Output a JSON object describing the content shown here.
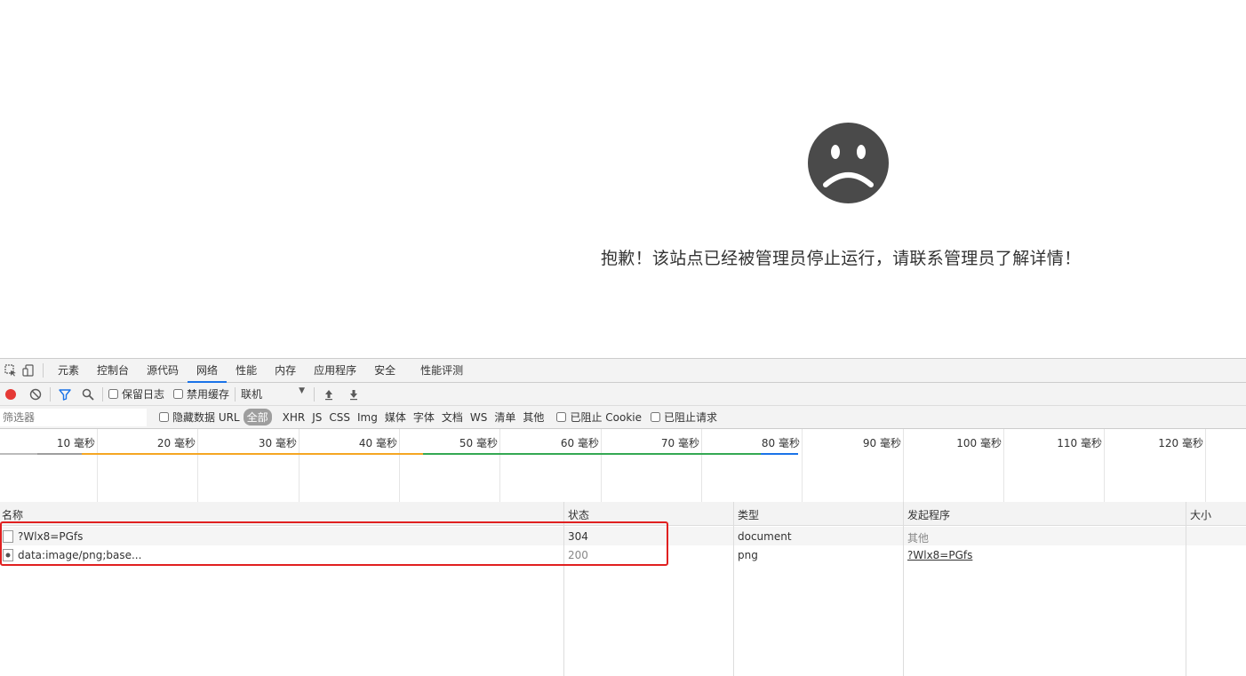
{
  "page": {
    "error_message": "抱歉！该站点已经被管理员停止运行，请联系管理员了解详情！"
  },
  "devtools": {
    "tabs": [
      "元素",
      "控制台",
      "源代码",
      "网络",
      "性能",
      "内存",
      "应用程序",
      "安全",
      "性能评测"
    ],
    "active_tab": "网络",
    "toolbar": {
      "preserve_log": "保留日志",
      "disable_cache": "禁用缓存",
      "throttle": "联机"
    },
    "filter": {
      "placeholder": "筛选器",
      "hide_data_urls": "隐藏数据 URL",
      "types": [
        "全部",
        "XHR",
        "JS",
        "CSS",
        "Img",
        "媒体",
        "字体",
        "文档",
        "WS",
        "清单",
        "其他"
      ],
      "blocked_cookies": "已阻止 Cookie",
      "blocked_requests": "已阻止请求"
    },
    "timeline_ticks": [
      "10 毫秒",
      "20 毫秒",
      "30 毫秒",
      "40 毫秒",
      "50 毫秒",
      "60 毫秒",
      "70 毫秒",
      "80 毫秒",
      "90 毫秒",
      "100 毫秒",
      "110 毫秒",
      "120 毫秒"
    ],
    "columns": {
      "name": "名称",
      "status": "状态",
      "type": "类型",
      "initiator": "发起程序",
      "size": "大小"
    },
    "rows": [
      {
        "name": "?Wlx8=PGfs",
        "status": "304",
        "type": "document",
        "initiator": "其他"
      },
      {
        "name": "data:image/png;base...",
        "status": "200",
        "type": "png",
        "initiator": "?Wlx8=PGfs"
      }
    ],
    "colors": {
      "record": "#e53935",
      "filter_active": "#1a73e8",
      "highlight": "#e02020"
    }
  }
}
